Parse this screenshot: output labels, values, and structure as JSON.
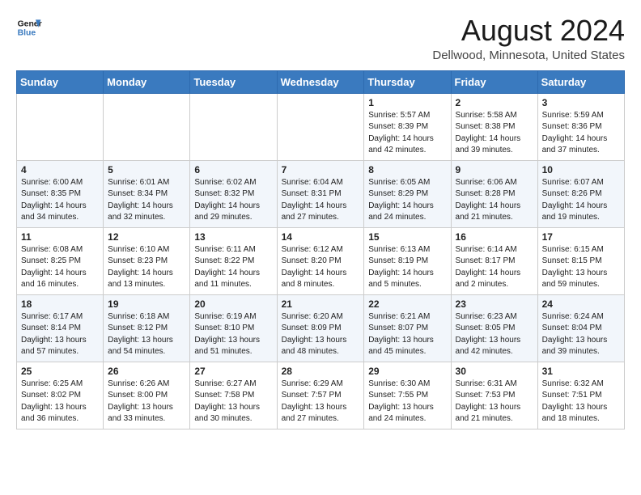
{
  "header": {
    "logo_line1": "General",
    "logo_line2": "Blue",
    "main_title": "August 2024",
    "subtitle": "Dellwood, Minnesota, United States"
  },
  "days_of_week": [
    "Sunday",
    "Monday",
    "Tuesday",
    "Wednesday",
    "Thursday",
    "Friday",
    "Saturday"
  ],
  "weeks": [
    {
      "days": [
        {
          "num": "",
          "info": ""
        },
        {
          "num": "",
          "info": ""
        },
        {
          "num": "",
          "info": ""
        },
        {
          "num": "",
          "info": ""
        },
        {
          "num": "1",
          "info": "Sunrise: 5:57 AM\nSunset: 8:39 PM\nDaylight: 14 hours\nand 42 minutes."
        },
        {
          "num": "2",
          "info": "Sunrise: 5:58 AM\nSunset: 8:38 PM\nDaylight: 14 hours\nand 39 minutes."
        },
        {
          "num": "3",
          "info": "Sunrise: 5:59 AM\nSunset: 8:36 PM\nDaylight: 14 hours\nand 37 minutes."
        }
      ]
    },
    {
      "days": [
        {
          "num": "4",
          "info": "Sunrise: 6:00 AM\nSunset: 8:35 PM\nDaylight: 14 hours\nand 34 minutes."
        },
        {
          "num": "5",
          "info": "Sunrise: 6:01 AM\nSunset: 8:34 PM\nDaylight: 14 hours\nand 32 minutes."
        },
        {
          "num": "6",
          "info": "Sunrise: 6:02 AM\nSunset: 8:32 PM\nDaylight: 14 hours\nand 29 minutes."
        },
        {
          "num": "7",
          "info": "Sunrise: 6:04 AM\nSunset: 8:31 PM\nDaylight: 14 hours\nand 27 minutes."
        },
        {
          "num": "8",
          "info": "Sunrise: 6:05 AM\nSunset: 8:29 PM\nDaylight: 14 hours\nand 24 minutes."
        },
        {
          "num": "9",
          "info": "Sunrise: 6:06 AM\nSunset: 8:28 PM\nDaylight: 14 hours\nand 21 minutes."
        },
        {
          "num": "10",
          "info": "Sunrise: 6:07 AM\nSunset: 8:26 PM\nDaylight: 14 hours\nand 19 minutes."
        }
      ]
    },
    {
      "days": [
        {
          "num": "11",
          "info": "Sunrise: 6:08 AM\nSunset: 8:25 PM\nDaylight: 14 hours\nand 16 minutes."
        },
        {
          "num": "12",
          "info": "Sunrise: 6:10 AM\nSunset: 8:23 PM\nDaylight: 14 hours\nand 13 minutes."
        },
        {
          "num": "13",
          "info": "Sunrise: 6:11 AM\nSunset: 8:22 PM\nDaylight: 14 hours\nand 11 minutes."
        },
        {
          "num": "14",
          "info": "Sunrise: 6:12 AM\nSunset: 8:20 PM\nDaylight: 14 hours\nand 8 minutes."
        },
        {
          "num": "15",
          "info": "Sunrise: 6:13 AM\nSunset: 8:19 PM\nDaylight: 14 hours\nand 5 minutes."
        },
        {
          "num": "16",
          "info": "Sunrise: 6:14 AM\nSunset: 8:17 PM\nDaylight: 14 hours\nand 2 minutes."
        },
        {
          "num": "17",
          "info": "Sunrise: 6:15 AM\nSunset: 8:15 PM\nDaylight: 13 hours\nand 59 minutes."
        }
      ]
    },
    {
      "days": [
        {
          "num": "18",
          "info": "Sunrise: 6:17 AM\nSunset: 8:14 PM\nDaylight: 13 hours\nand 57 minutes."
        },
        {
          "num": "19",
          "info": "Sunrise: 6:18 AM\nSunset: 8:12 PM\nDaylight: 13 hours\nand 54 minutes."
        },
        {
          "num": "20",
          "info": "Sunrise: 6:19 AM\nSunset: 8:10 PM\nDaylight: 13 hours\nand 51 minutes."
        },
        {
          "num": "21",
          "info": "Sunrise: 6:20 AM\nSunset: 8:09 PM\nDaylight: 13 hours\nand 48 minutes."
        },
        {
          "num": "22",
          "info": "Sunrise: 6:21 AM\nSunset: 8:07 PM\nDaylight: 13 hours\nand 45 minutes."
        },
        {
          "num": "23",
          "info": "Sunrise: 6:23 AM\nSunset: 8:05 PM\nDaylight: 13 hours\nand 42 minutes."
        },
        {
          "num": "24",
          "info": "Sunrise: 6:24 AM\nSunset: 8:04 PM\nDaylight: 13 hours\nand 39 minutes."
        }
      ]
    },
    {
      "days": [
        {
          "num": "25",
          "info": "Sunrise: 6:25 AM\nSunset: 8:02 PM\nDaylight: 13 hours\nand 36 minutes."
        },
        {
          "num": "26",
          "info": "Sunrise: 6:26 AM\nSunset: 8:00 PM\nDaylight: 13 hours\nand 33 minutes."
        },
        {
          "num": "27",
          "info": "Sunrise: 6:27 AM\nSunset: 7:58 PM\nDaylight: 13 hours\nand 30 minutes."
        },
        {
          "num": "28",
          "info": "Sunrise: 6:29 AM\nSunset: 7:57 PM\nDaylight: 13 hours\nand 27 minutes."
        },
        {
          "num": "29",
          "info": "Sunrise: 6:30 AM\nSunset: 7:55 PM\nDaylight: 13 hours\nand 24 minutes."
        },
        {
          "num": "30",
          "info": "Sunrise: 6:31 AM\nSunset: 7:53 PM\nDaylight: 13 hours\nand 21 minutes."
        },
        {
          "num": "31",
          "info": "Sunrise: 6:32 AM\nSunset: 7:51 PM\nDaylight: 13 hours\nand 18 minutes."
        }
      ]
    }
  ]
}
